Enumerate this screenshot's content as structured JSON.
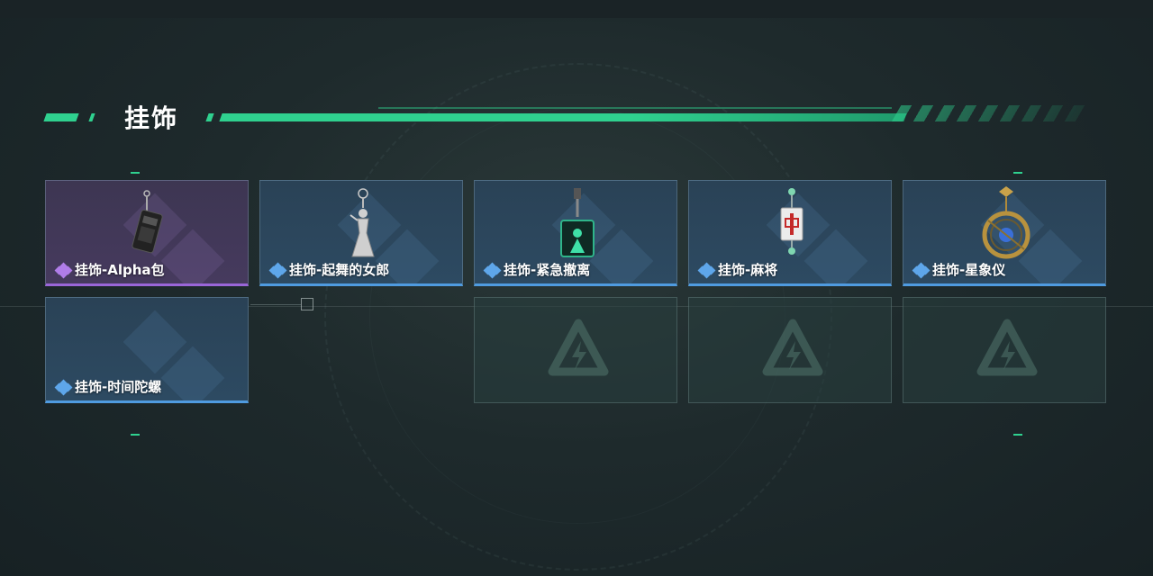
{
  "section": {
    "title": "挂饰"
  },
  "items": [
    {
      "name": "挂饰-Alpha包",
      "rarity": "purple",
      "icon": "alpha-bag-charm-icon"
    },
    {
      "name": "挂饰-起舞的女郎",
      "rarity": "blue",
      "icon": "dancing-lady-charm-icon"
    },
    {
      "name": "挂饰-紧急撤离",
      "rarity": "blue",
      "icon": "emergency-evac-charm-icon"
    },
    {
      "name": "挂饰-麻将",
      "rarity": "blue",
      "icon": "mahjong-charm-icon"
    },
    {
      "name": "挂饰-星象仪",
      "rarity": "blue",
      "icon": "astrolabe-charm-icon"
    },
    {
      "name": "挂饰-时间陀螺",
      "rarity": "blue",
      "icon": "time-gyro-charm-icon"
    }
  ],
  "empty_slots": 3,
  "colors": {
    "accent": "#2fd18f",
    "rarity_blue": "#4f9be0",
    "rarity_purple": "#9a66d8"
  }
}
